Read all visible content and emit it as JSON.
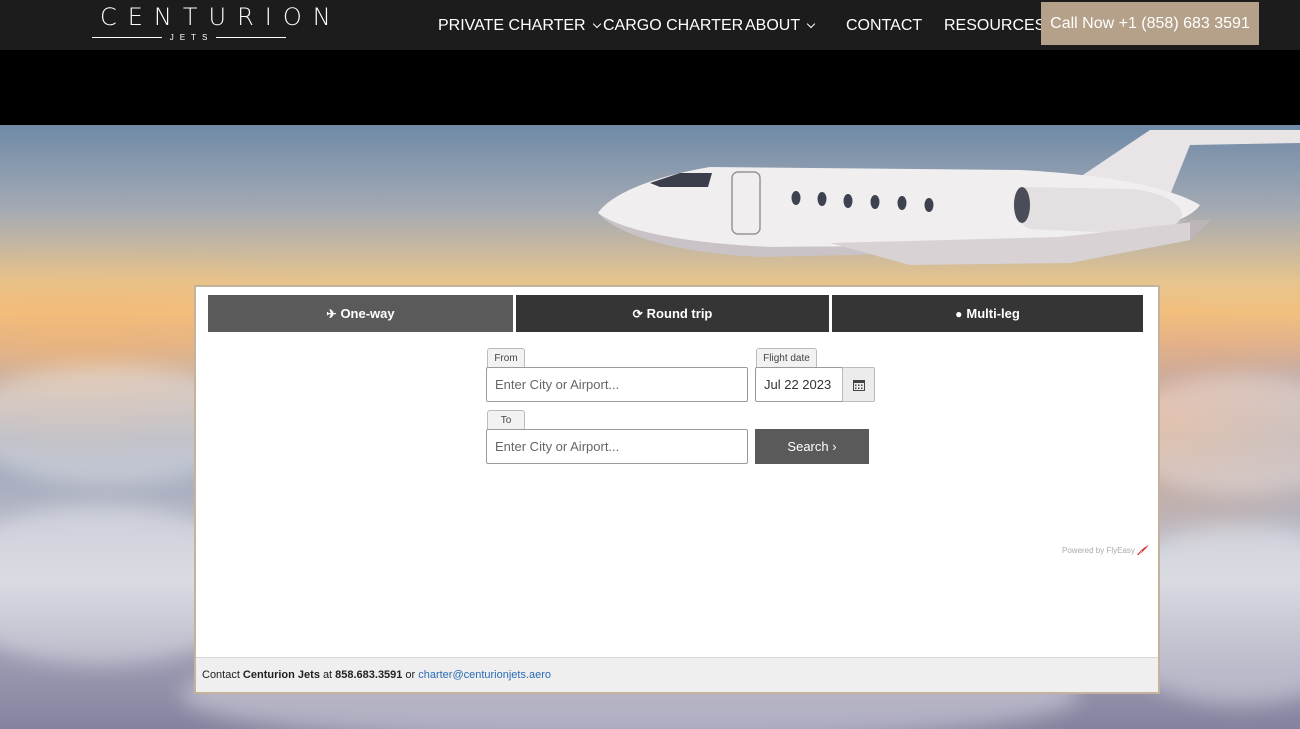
{
  "brand": {
    "name": "CENTURION",
    "sub": "JETS"
  },
  "nav": {
    "items": [
      {
        "label": "PRIVATE CHARTER",
        "has_dropdown": true
      },
      {
        "label": "CARGO CHARTER",
        "has_dropdown": false
      },
      {
        "label": "ABOUT",
        "has_dropdown": true
      },
      {
        "label": "CONTACT",
        "has_dropdown": false
      },
      {
        "label": "RESOURCES",
        "has_dropdown": true
      }
    ],
    "call_label": "Call Now +1 (858) 683 3591"
  },
  "widget": {
    "tabs": [
      {
        "label": "One-way",
        "icon": "plane-icon",
        "active": true
      },
      {
        "label": "Round trip",
        "icon": "refresh-icon",
        "active": false
      },
      {
        "label": "Multi-leg",
        "icon": "globe-icon",
        "active": false
      }
    ],
    "from_label": "From",
    "from_placeholder": "Enter City or Airport...",
    "to_label": "To",
    "to_placeholder": "Enter City or Airport...",
    "date_label": "Flight date",
    "date_value": "Jul 22 2023",
    "search_label": "Search ›",
    "powered_by": "Powered by FlyEasy",
    "footer": {
      "prefix": "Contact",
      "company": "Centurion Jets",
      "at": "at",
      "phone": "858.683.3591",
      "or": "or",
      "email": "charter@centurionjets.aero"
    }
  },
  "colors": {
    "accent": "#b5a089",
    "tab_active": "#5a5a5a",
    "tab_inactive": "#353535",
    "link": "#2a6bb5"
  }
}
